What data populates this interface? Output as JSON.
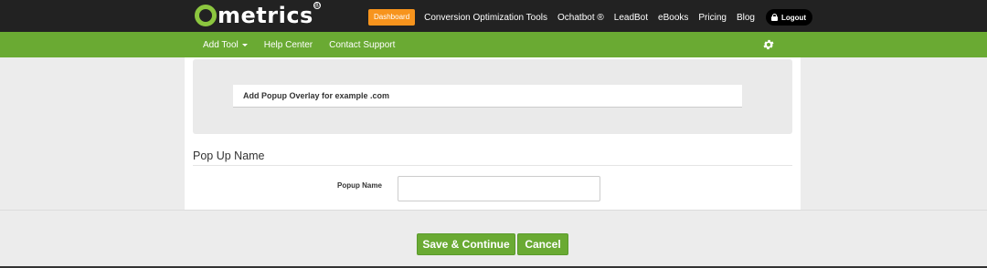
{
  "header": {
    "logo_text": "metrics",
    "logo_registered": "®",
    "dashboard_label": "Dashboard",
    "nav_links": [
      "Conversion Optimization Tools",
      "Ochatbot ®",
      "LeadBot",
      "eBooks",
      "Pricing",
      "Blog"
    ],
    "logout_label": "Logout"
  },
  "subnav": {
    "items": [
      "Add Tool",
      "Help Center",
      "Contact Support"
    ]
  },
  "main": {
    "panel_heading": "Add Popup Overlay for  example .com",
    "section_title": "Pop Up Name",
    "popup_name_label": "Popup Name",
    "popup_name_value": ""
  },
  "actions": {
    "save_label": "Save & Continue",
    "cancel_label": "Cancel"
  },
  "colors": {
    "topbar": "#222222",
    "green": "#6aaa33",
    "dashboard_orange": "#f7941d",
    "logo_green": "#8cc63f"
  }
}
